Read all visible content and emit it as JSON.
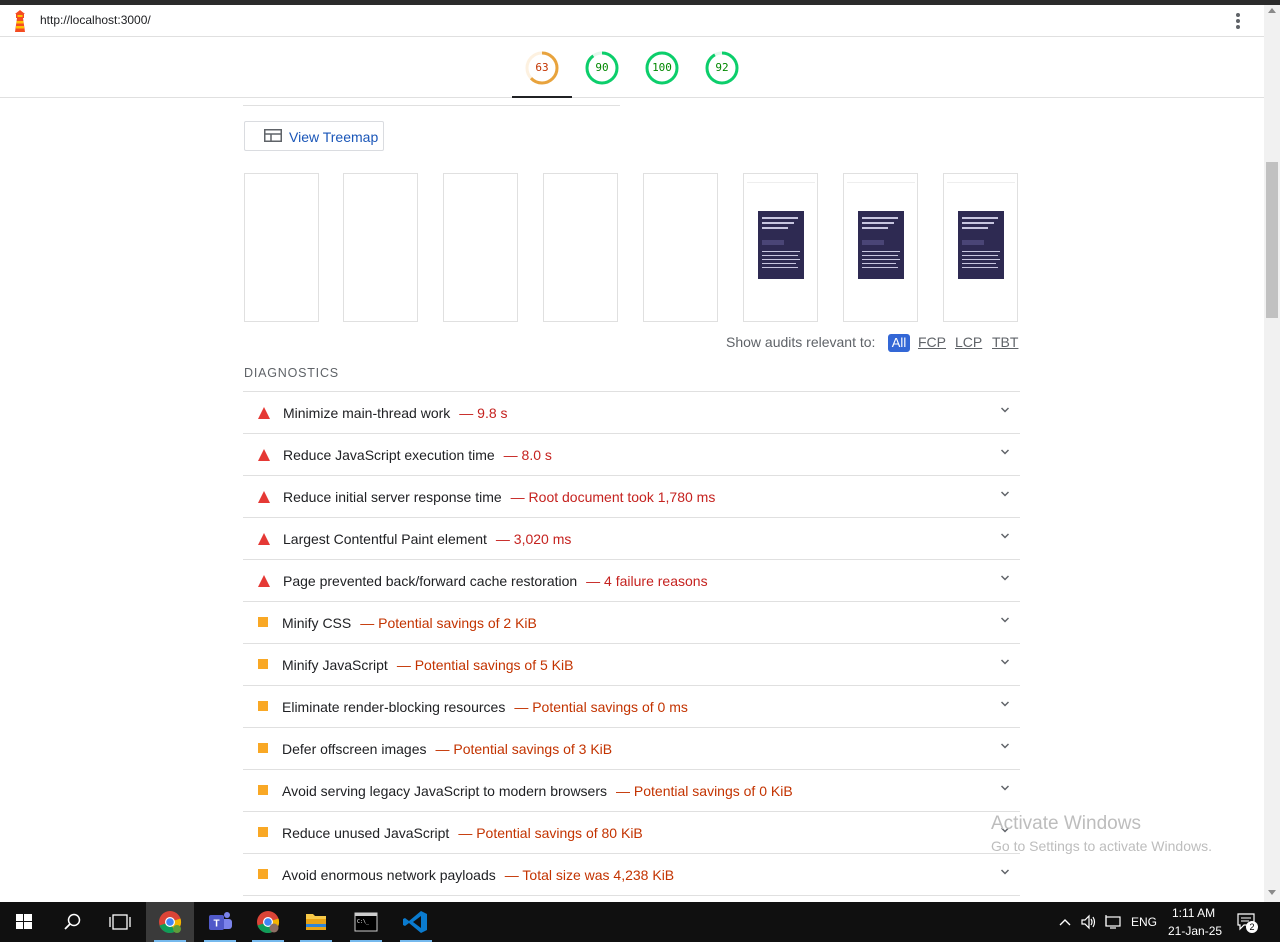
{
  "browser": {
    "url": "http://localhost:3000/"
  },
  "gauges": [
    {
      "score": "63",
      "color": "#e8a33d",
      "fraction": 0.63
    },
    {
      "score": "90",
      "color": "#0cce6b",
      "fraction": 0.9
    },
    {
      "score": "100",
      "color": "#0cce6b",
      "fraction": 1.0
    },
    {
      "score": "92",
      "color": "#0cce6b",
      "fraction": 0.92
    }
  ],
  "treemap": {
    "label": "View Treemap"
  },
  "filmstrip": {
    "frames": [
      "blank",
      "blank",
      "blank",
      "blank",
      "blank",
      "rendered",
      "rendered",
      "rendered"
    ]
  },
  "filter": {
    "label": "Show audits relevant to:",
    "options": [
      "All",
      "FCP",
      "LCP",
      "TBT"
    ]
  },
  "diagnostics": {
    "title": "DIAGNOSTICS",
    "items": [
      {
        "severity": "fail",
        "title": "Minimize main-thread work",
        "detail": "— 9.8 s"
      },
      {
        "severity": "fail",
        "title": "Reduce JavaScript execution time",
        "detail": "— 8.0 s"
      },
      {
        "severity": "fail",
        "title": "Reduce initial server response time",
        "detail": "— Root document took 1,780 ms"
      },
      {
        "severity": "fail",
        "title": "Largest Contentful Paint element",
        "detail": "— 3,020 ms"
      },
      {
        "severity": "fail",
        "title": "Page prevented back/forward cache restoration",
        "detail": "— 4 failure reasons"
      },
      {
        "severity": "warn",
        "title": "Minify CSS",
        "detail": "— Potential savings of 2 KiB"
      },
      {
        "severity": "warn",
        "title": "Minify JavaScript",
        "detail": "— Potential savings of 5 KiB"
      },
      {
        "severity": "warn",
        "title": "Eliminate render-blocking resources",
        "detail": "— Potential savings of 0 ms"
      },
      {
        "severity": "warn",
        "title": "Defer offscreen images",
        "detail": "— Potential savings of 3 KiB"
      },
      {
        "severity": "warn",
        "title": "Avoid serving legacy JavaScript to modern browsers",
        "detail": "— Potential savings of 0 KiB"
      },
      {
        "severity": "warn",
        "title": "Reduce unused JavaScript",
        "detail": "— Potential savings of 80 KiB"
      },
      {
        "severity": "warn",
        "title": "Avoid enormous network payloads",
        "detail": "— Total size was 4,238 KiB"
      }
    ]
  },
  "colors": {
    "fail": "#e53935",
    "fail_text": "#c5221f",
    "warn": "#f9a825",
    "warn_text": "#c33300"
  },
  "watermark": {
    "line1": "Activate Windows",
    "line2": "Go to Settings to activate Windows."
  },
  "taskbar": {
    "lang": "ENG",
    "time": "1:11 AM",
    "date": "21-Jan-25",
    "notifications": "2",
    "apps": [
      "windows-start",
      "search",
      "task-view",
      "chrome",
      "teams",
      "chrome-alt",
      "file-explorer",
      "terminal",
      "vscode"
    ]
  }
}
